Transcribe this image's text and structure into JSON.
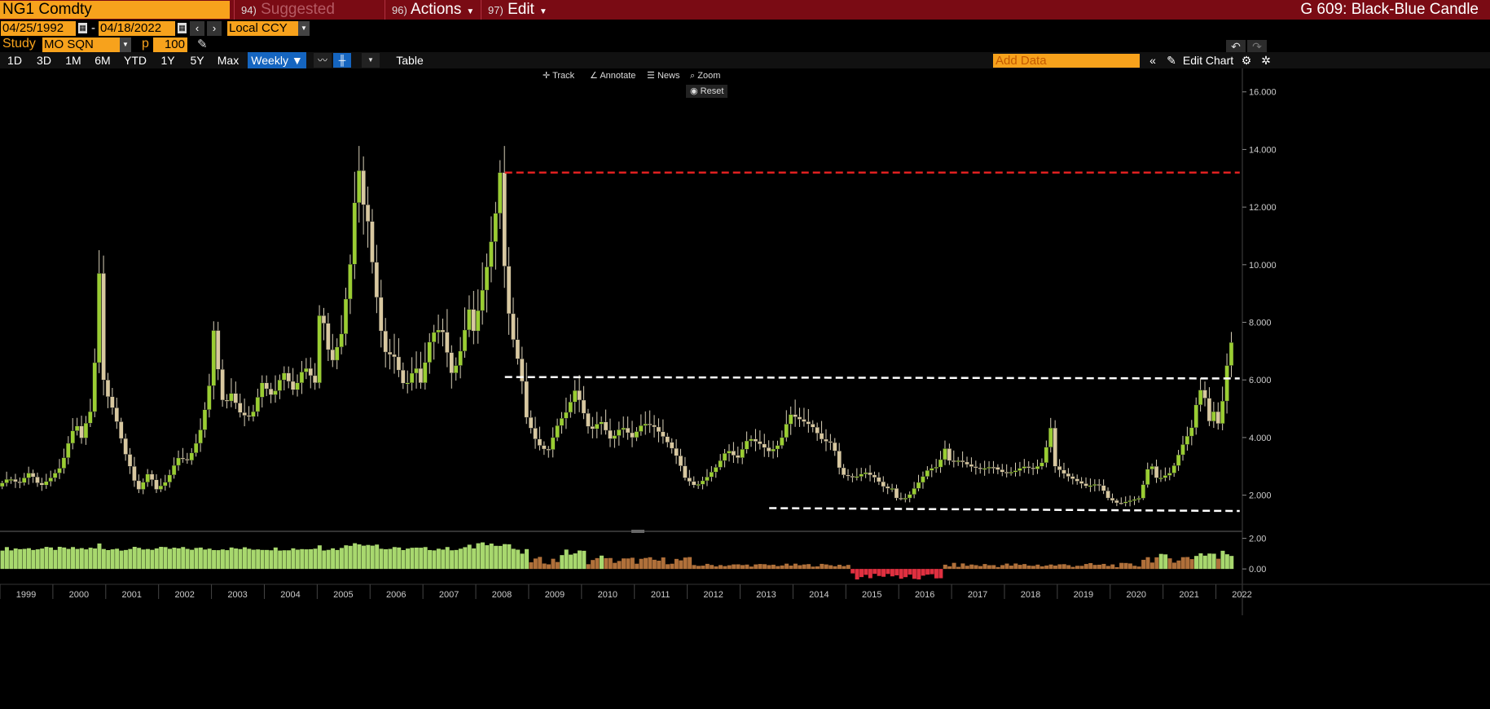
{
  "header": {
    "ticker": "NG1 Comdty",
    "menus": [
      {
        "num": "94)",
        "label": "Suggested Charts"
      },
      {
        "num": "96)",
        "label": "Actions"
      },
      {
        "num": "97)",
        "label": "Edit"
      }
    ],
    "chart_title": "G 609: Black-Blue Candle"
  },
  "dates": {
    "start": "04/25/1992",
    "separator": "-",
    "end": "04/18/2022",
    "currency": "Local CCY"
  },
  "study": {
    "label": "Study",
    "value": "MO SQN",
    "p_label": "p",
    "p_value": "100"
  },
  "toolbar": {
    "periods": [
      "1D",
      "3D",
      "1M",
      "6M",
      "YTD",
      "1Y",
      "5Y",
      "Max"
    ],
    "frequency": "Weekly ▼",
    "table_label": "Table",
    "add_data_placeholder": "Add Data",
    "edit_chart_label": "Edit Chart"
  },
  "chart_tools": {
    "track": "Track",
    "annotate": "Annotate",
    "news": "News",
    "zoom": "Zoom",
    "reset": "Reset"
  },
  "icons": [
    "calendar-icon",
    "chevron-left-icon",
    "chevron-right-icon",
    "dropdown-caret-icon",
    "pencil-icon",
    "line-chart-icon",
    "candle-chart-icon",
    "double-chevron-left-icon",
    "edit-pencil-icon",
    "settings-icon",
    "gear-icon",
    "undo-icon",
    "redo-icon",
    "crosshair-icon",
    "magnifier-icon"
  ],
  "colors": {
    "bg": "#000000",
    "ticker_bg": "#f7a21c",
    "titlebar_bg": "#7a0b14",
    "candle_up": "#9acd32",
    "candle_down": "#d8c8a0",
    "resistance_red": "#e02020",
    "support_white": "#ffffff",
    "osc_pos": "#a8d86e",
    "osc_mid": "#b0703a",
    "osc_neg": "#e03040",
    "selected": "#1565c0"
  },
  "chart_data": [
    {
      "type": "candlestick",
      "frequency": "monthly-approx",
      "ylim": [
        0.8,
        16.7
      ],
      "y_ticks": [
        "16.000",
        "14.000",
        "12.000",
        "10.000",
        "8.000",
        "6.000",
        "4.000",
        "2.000"
      ],
      "x_ticks": [
        "1999",
        "2000",
        "2001",
        "2002",
        "2003",
        "2004",
        "2005",
        "2006",
        "2007",
        "2008",
        "2009",
        "2010",
        "2011",
        "2012",
        "2013",
        "2014",
        "2015",
        "2016",
        "2017",
        "2018",
        "2019",
        "2020",
        "2021",
        "2022"
      ],
      "x_range": [
        1999.0,
        2022.5
      ],
      "close_path": [
        [
          1999.0,
          2.3
        ],
        [
          1999.2,
          2.6
        ],
        [
          1999.4,
          2.4
        ],
        [
          1999.6,
          2.8
        ],
        [
          1999.8,
          2.3
        ],
        [
          2000.0,
          2.6
        ],
        [
          2000.2,
          3.0
        ],
        [
          2000.4,
          4.2
        ],
        [
          2000.5,
          4.4
        ],
        [
          2000.6,
          3.9
        ],
        [
          2000.7,
          4.8
        ],
        [
          2000.8,
          5.0
        ],
        [
          2000.9,
          9.8
        ],
        [
          2000.95,
          9.5
        ],
        [
          2001.0,
          6.0
        ],
        [
          2001.1,
          5.3
        ],
        [
          2001.2,
          4.9
        ],
        [
          2001.3,
          4.2
        ],
        [
          2001.4,
          3.5
        ],
        [
          2001.5,
          3.0
        ],
        [
          2001.6,
          2.4
        ],
        [
          2001.7,
          2.1
        ],
        [
          2001.8,
          2.8
        ],
        [
          2001.9,
          2.6
        ],
        [
          2002.0,
          2.2
        ],
        [
          2002.2,
          2.5
        ],
        [
          2002.4,
          3.3
        ],
        [
          2002.6,
          3.2
        ],
        [
          2002.8,
          4.0
        ],
        [
          2002.9,
          4.8
        ],
        [
          2003.0,
          5.8
        ],
        [
          2003.1,
          8.1
        ],
        [
          2003.2,
          5.5
        ],
        [
          2003.3,
          5.1
        ],
        [
          2003.4,
          5.6
        ],
        [
          2003.6,
          4.8
        ],
        [
          2003.8,
          4.7
        ],
        [
          2004.0,
          5.9
        ],
        [
          2004.2,
          5.4
        ],
        [
          2004.4,
          6.3
        ],
        [
          2004.6,
          5.6
        ],
        [
          2004.8,
          6.5
        ],
        [
          2004.9,
          6.2
        ],
        [
          2005.0,
          5.9
        ],
        [
          2005.1,
          8.7
        ],
        [
          2005.3,
          6.5
        ],
        [
          2005.5,
          7.6
        ],
        [
          2005.7,
          10.5
        ],
        [
          2005.8,
          13.8
        ],
        [
          2005.9,
          12.2
        ],
        [
          2006.0,
          11.5
        ],
        [
          2006.1,
          9.8
        ],
        [
          2006.3,
          7.0
        ],
        [
          2006.5,
          6.8
        ],
        [
          2006.7,
          5.7
        ],
        [
          2006.9,
          6.5
        ],
        [
          2007.0,
          5.9
        ],
        [
          2007.2,
          7.6
        ],
        [
          2007.4,
          7.8
        ],
        [
          2007.6,
          6.1
        ],
        [
          2007.8,
          7.3
        ],
        [
          2007.9,
          8.6
        ],
        [
          2008.0,
          7.7
        ],
        [
          2008.2,
          9.4
        ],
        [
          2008.4,
          11.5
        ],
        [
          2008.5,
          13.2
        ],
        [
          2008.6,
          9.3
        ],
        [
          2008.7,
          7.8
        ],
        [
          2008.9,
          6.2
        ],
        [
          2009.0,
          4.7
        ],
        [
          2009.2,
          3.8
        ],
        [
          2009.4,
          3.5
        ],
        [
          2009.6,
          4.5
        ],
        [
          2009.8,
          5.0
        ],
        [
          2009.9,
          5.7
        ],
        [
          2010.0,
          5.3
        ],
        [
          2010.2,
          4.2
        ],
        [
          2010.4,
          4.6
        ],
        [
          2010.6,
          3.9
        ],
        [
          2010.8,
          4.4
        ],
        [
          2010.9,
          4.2
        ],
        [
          2011.0,
          4.0
        ],
        [
          2011.2,
          4.5
        ],
        [
          2011.4,
          4.4
        ],
        [
          2011.6,
          4.0
        ],
        [
          2011.8,
          3.5
        ],
        [
          2011.9,
          3.1
        ],
        [
          2012.0,
          2.6
        ],
        [
          2012.2,
          2.3
        ],
        [
          2012.4,
          2.6
        ],
        [
          2012.6,
          3.0
        ],
        [
          2012.8,
          3.6
        ],
        [
          2012.9,
          3.4
        ],
        [
          2013.0,
          3.3
        ],
        [
          2013.2,
          4.0
        ],
        [
          2013.4,
          3.8
        ],
        [
          2013.6,
          3.5
        ],
        [
          2013.8,
          3.8
        ],
        [
          2013.9,
          4.4
        ],
        [
          2014.0,
          4.8
        ],
        [
          2014.2,
          4.6
        ],
        [
          2014.4,
          4.4
        ],
        [
          2014.6,
          3.9
        ],
        [
          2014.8,
          3.8
        ],
        [
          2014.9,
          3.0
        ],
        [
          2015.0,
          2.7
        ],
        [
          2015.2,
          2.6
        ],
        [
          2015.4,
          2.8
        ],
        [
          2015.6,
          2.6
        ],
        [
          2015.8,
          2.2
        ],
        [
          2015.9,
          2.3
        ],
        [
          2016.0,
          1.9
        ],
        [
          2016.2,
          1.9
        ],
        [
          2016.4,
          2.4
        ],
        [
          2016.6,
          2.9
        ],
        [
          2016.8,
          3.0
        ],
        [
          2016.9,
          3.7
        ],
        [
          2017.0,
          3.2
        ],
        [
          2017.2,
          3.2
        ],
        [
          2017.4,
          3.0
        ],
        [
          2017.6,
          2.9
        ],
        [
          2017.8,
          3.0
        ],
        [
          2017.9,
          2.9
        ],
        [
          2018.0,
          2.8
        ],
        [
          2018.2,
          2.8
        ],
        [
          2018.4,
          3.0
        ],
        [
          2018.6,
          2.9
        ],
        [
          2018.8,
          3.2
        ],
        [
          2018.9,
          4.6
        ],
        [
          2019.0,
          3.0
        ],
        [
          2019.2,
          2.7
        ],
        [
          2019.4,
          2.5
        ],
        [
          2019.6,
          2.3
        ],
        [
          2019.8,
          2.4
        ],
        [
          2019.9,
          2.2
        ],
        [
          2020.0,
          1.9
        ],
        [
          2020.2,
          1.7
        ],
        [
          2020.4,
          1.8
        ],
        [
          2020.6,
          1.9
        ],
        [
          2020.7,
          2.6
        ],
        [
          2020.8,
          3.2
        ],
        [
          2020.9,
          2.6
        ],
        [
          2021.0,
          2.6
        ],
        [
          2021.2,
          2.8
        ],
        [
          2021.4,
          3.7
        ],
        [
          2021.6,
          4.4
        ],
        [
          2021.7,
          5.5
        ],
        [
          2021.8,
          5.8
        ],
        [
          2021.9,
          4.5
        ],
        [
          2022.0,
          4.9
        ],
        [
          2022.1,
          4.4
        ],
        [
          2022.2,
          5.7
        ],
        [
          2022.3,
          7.3
        ]
      ],
      "annotations": [
        {
          "type": "hline",
          "style": "dashed",
          "color": "red",
          "y": 13.2,
          "x_from": 2008.55,
          "x_to": 2022.45
        },
        {
          "type": "hline",
          "style": "dashed",
          "color": "white",
          "y_from": 6.1,
          "y_to": 6.05,
          "x_from": 2008.55,
          "x_to": 2022.45
        },
        {
          "type": "hline",
          "style": "dashed",
          "color": "white",
          "y_from": 1.55,
          "y_to": 1.45,
          "x_from": 2013.55,
          "x_to": 2022.45
        }
      ]
    },
    {
      "type": "bar",
      "name": "MO SQN oscillator",
      "ylim": [
        -0.9,
        2.3
      ],
      "y_ticks": [
        "2.00",
        "0.00"
      ]
    }
  ]
}
